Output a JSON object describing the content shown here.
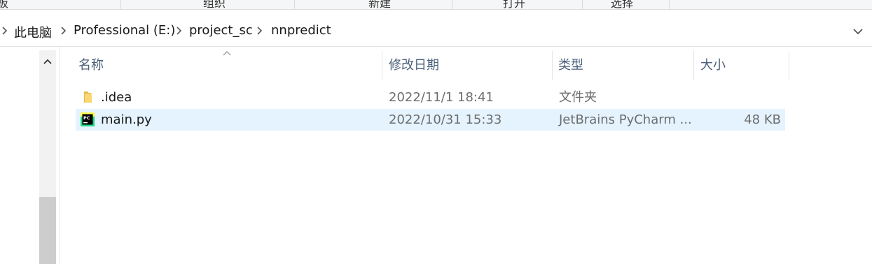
{
  "ribbon": {
    "groups": [
      "板",
      "组织",
      "新建",
      "打开",
      "选择"
    ]
  },
  "address_bar": {
    "crumbs": [
      "此电脑",
      "Professional (E:)",
      "project_sc",
      "nnpredict"
    ],
    "dropdown_icon": "chevron-down-icon"
  },
  "columns": {
    "name": "名称",
    "modified": "修改日期",
    "type": "类型",
    "size": "大小"
  },
  "files": [
    {
      "name": ".idea",
      "modified": "2022/11/1 18:41",
      "type": "文件夹",
      "size": "",
      "icon": "folder-icon",
      "selected": false
    },
    {
      "name": "main.py",
      "modified": "2022/10/31 15:33",
      "type": "JetBrains PyCharm ...",
      "size": "48 KB",
      "icon": "pycharm-file-icon",
      "selected": true
    }
  ],
  "colors": {
    "selection": "#e5f3ff",
    "header_text": "#4c607a",
    "folder": "#f8d775"
  }
}
